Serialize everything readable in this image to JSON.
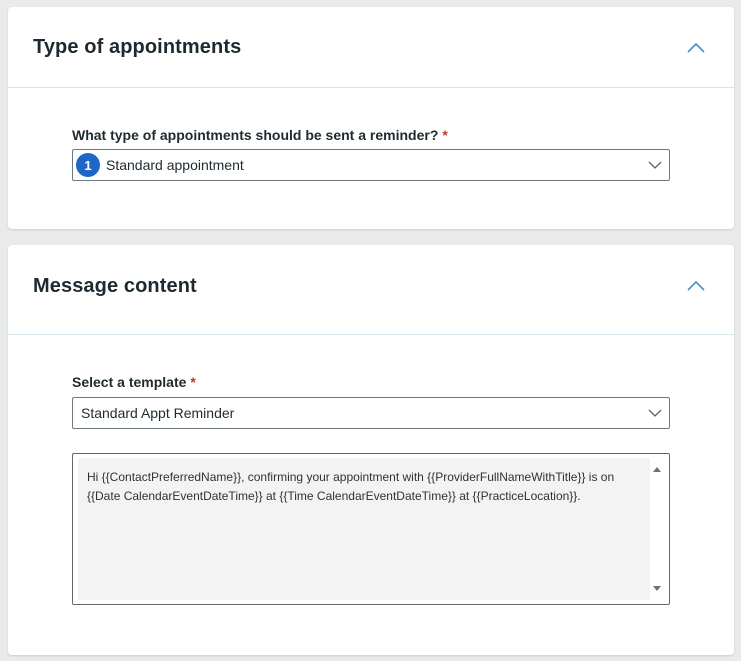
{
  "appointments_section": {
    "title": "Type of appointments",
    "question_label": "What type of appointments should be sent a reminder?",
    "required_marker": "*",
    "selected": {
      "count_badge": "1",
      "value": "Standard appointment"
    }
  },
  "message_section": {
    "title": "Message content",
    "template_label": "Select a template",
    "required_marker": "*",
    "template_value": "Standard Appt Reminder",
    "message_text": "Hi {{ContactPreferredName}}, confirming your appointment with {{ProviderFullNameWithTitle}} is on {{Date CalendarEventDateTime}} at {{Time CalendarEventDateTime}} at {{PracticeLocation}}."
  },
  "colors": {
    "badge": "#1e66c8",
    "chevron": "#4a90c8",
    "required": "#c0392b",
    "message_background": "#f3f3f3"
  },
  "icons": {
    "collapse": "chevron-up-icon",
    "dropdown": "chevron-down-icon",
    "scroll_up": "triangle-up-icon",
    "scroll_down": "triangle-down-icon"
  }
}
